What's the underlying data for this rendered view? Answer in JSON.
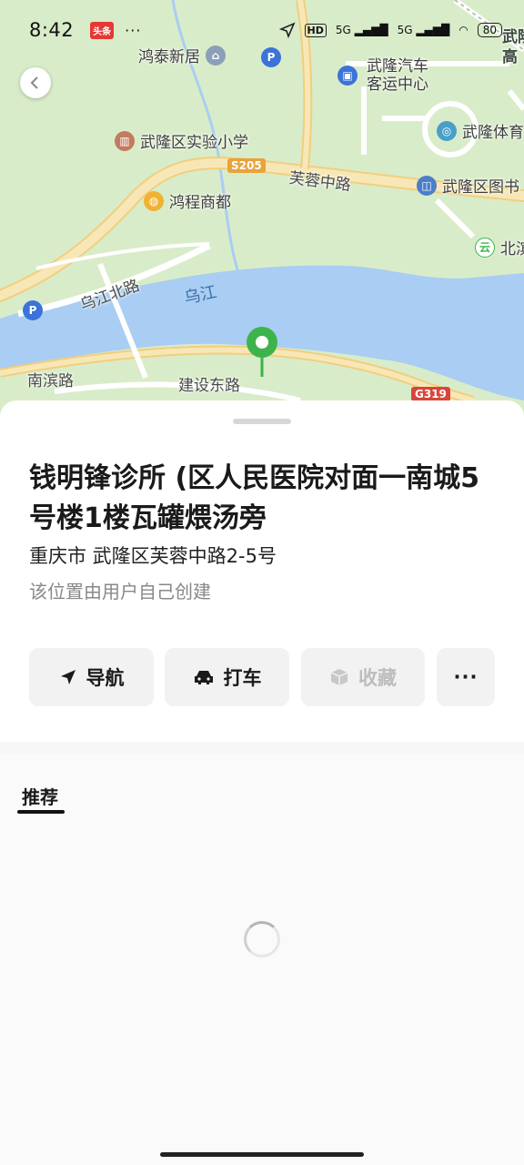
{
  "status_bar": {
    "time": "8:42",
    "app_badge": "头条",
    "more_dots": "···",
    "hd_label": "HD",
    "network_1": "5G",
    "network_2": "5G",
    "battery": "80"
  },
  "map": {
    "labels": {
      "hongtai": "鸿泰新居",
      "wulong_bus": "武隆汽车",
      "wulong_bus_2": "客运中心",
      "school": "武隆区实验小学",
      "wulong_sports": "武隆体育",
      "furong_road": "芙蓉中路",
      "library": "武隆区图书",
      "mall": "鸿程商都",
      "beibin": "北滨",
      "wujiang_north": "乌江北路",
      "wujiang": "乌江",
      "nanbin": "南滨路",
      "jianshe_east": "建设东路",
      "corner_top": "武隆",
      "corner_top_2": "高"
    },
    "shields": {
      "s205": "S205",
      "g319": "G319"
    },
    "colors": {
      "land": "#d9ecc9",
      "water": "#a9cdf3",
      "road_main": "#f5dfa6",
      "pin": "#3cb44b"
    }
  },
  "place": {
    "title": "钱明锋诊所 (区人民医院对面一南城5号楼1楼瓦罐煨汤旁",
    "address": "重庆市 武隆区芙蓉中路2-5号",
    "note": "该位置由用户自己创建"
  },
  "actions": {
    "navigate": "导航",
    "taxi": "打车",
    "favorite": "收藏",
    "more": "···"
  },
  "recommend": {
    "tab_label": "推荐"
  }
}
